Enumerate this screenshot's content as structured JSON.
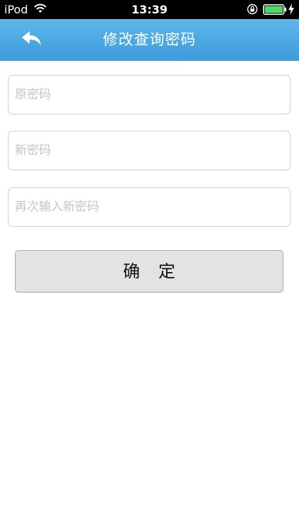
{
  "status_bar": {
    "carrier": "iPod",
    "time": "13:39",
    "wifi_icon": "wifi-icon",
    "lock_icon": "rotation-lock-icon",
    "battery_icon": "battery-icon",
    "battery_color": "#4cd964"
  },
  "header": {
    "back_icon": "back-arrow-icon",
    "title": "修改查询密码",
    "bar_color": "#4aa8e2"
  },
  "form": {
    "old_password_placeholder": "原密码",
    "new_password_placeholder": "新密码",
    "confirm_password_placeholder": "再次输入新密码",
    "old_password_value": "",
    "new_password_value": "",
    "confirm_password_value": ""
  },
  "actions": {
    "confirm_label": "确定"
  }
}
